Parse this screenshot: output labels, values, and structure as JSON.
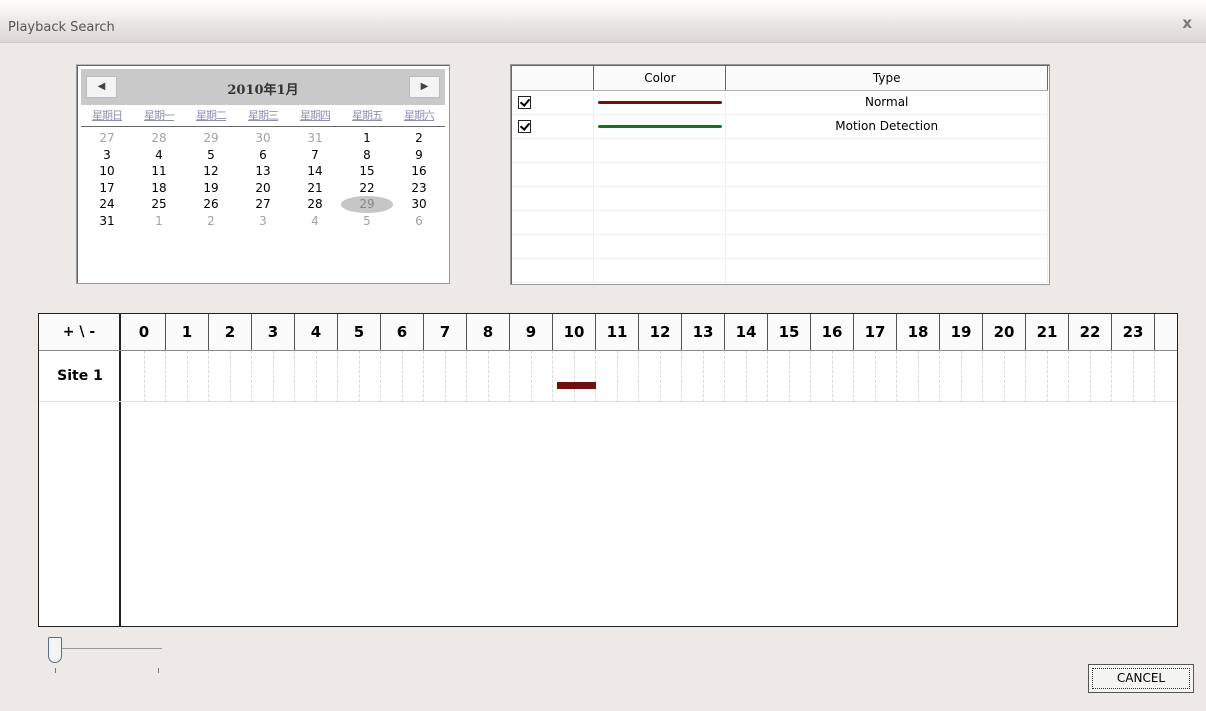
{
  "window": {
    "title": "Playback Search",
    "close_glyph": "x"
  },
  "calendar": {
    "month_label": "2010年1月",
    "prev_glyph": "◀",
    "next_glyph": "▶",
    "weekdays": [
      "星期日",
      "星期一",
      "星期二",
      "星期三",
      "星期四",
      "星期五",
      "星期六"
    ],
    "days": [
      {
        "d": "27",
        "other": true
      },
      {
        "d": "28",
        "other": true
      },
      {
        "d": "29",
        "other": true
      },
      {
        "d": "30",
        "other": true
      },
      {
        "d": "31",
        "other": true
      },
      {
        "d": "1"
      },
      {
        "d": "2"
      },
      {
        "d": "3"
      },
      {
        "d": "4"
      },
      {
        "d": "5"
      },
      {
        "d": "6"
      },
      {
        "d": "7"
      },
      {
        "d": "8"
      },
      {
        "d": "9"
      },
      {
        "d": "10"
      },
      {
        "d": "11"
      },
      {
        "d": "12"
      },
      {
        "d": "13"
      },
      {
        "d": "14"
      },
      {
        "d": "15"
      },
      {
        "d": "16"
      },
      {
        "d": "17"
      },
      {
        "d": "18"
      },
      {
        "d": "19"
      },
      {
        "d": "20"
      },
      {
        "d": "21"
      },
      {
        "d": "22"
      },
      {
        "d": "23"
      },
      {
        "d": "24"
      },
      {
        "d": "25"
      },
      {
        "d": "26"
      },
      {
        "d": "27"
      },
      {
        "d": "28"
      },
      {
        "d": "29",
        "selected": true
      },
      {
        "d": "30"
      },
      {
        "d": "31"
      },
      {
        "d": "1",
        "other": true
      },
      {
        "d": "2",
        "other": true
      },
      {
        "d": "3",
        "other": true
      },
      {
        "d": "4",
        "other": true
      },
      {
        "d": "5",
        "other": true
      },
      {
        "d": "6",
        "other": true
      }
    ]
  },
  "legend": {
    "headers": {
      "check": "",
      "color": "Color",
      "type": "Type"
    },
    "rows": [
      {
        "checked": true,
        "color": "#7a0d0d",
        "type": "Normal"
      },
      {
        "checked": true,
        "color": "#0d7a1a",
        "type": "Motion Detection"
      }
    ]
  },
  "timeline": {
    "corner_label": "+ \\ -",
    "hours": [
      "0",
      "1",
      "2",
      "3",
      "4",
      "5",
      "6",
      "7",
      "8",
      "9",
      "10",
      "11",
      "12",
      "13",
      "14",
      "15",
      "16",
      "17",
      "18",
      "19",
      "20",
      "21",
      "22",
      "23"
    ],
    "sites": [
      {
        "name": "Site 1",
        "records": [
          {
            "start_hour": 10.1,
            "end_hour": 11.0,
            "color": "#700f10"
          }
        ]
      }
    ]
  },
  "zoom_slider": {
    "level": 0
  },
  "buttons": {
    "cancel": "CANCEL"
  }
}
